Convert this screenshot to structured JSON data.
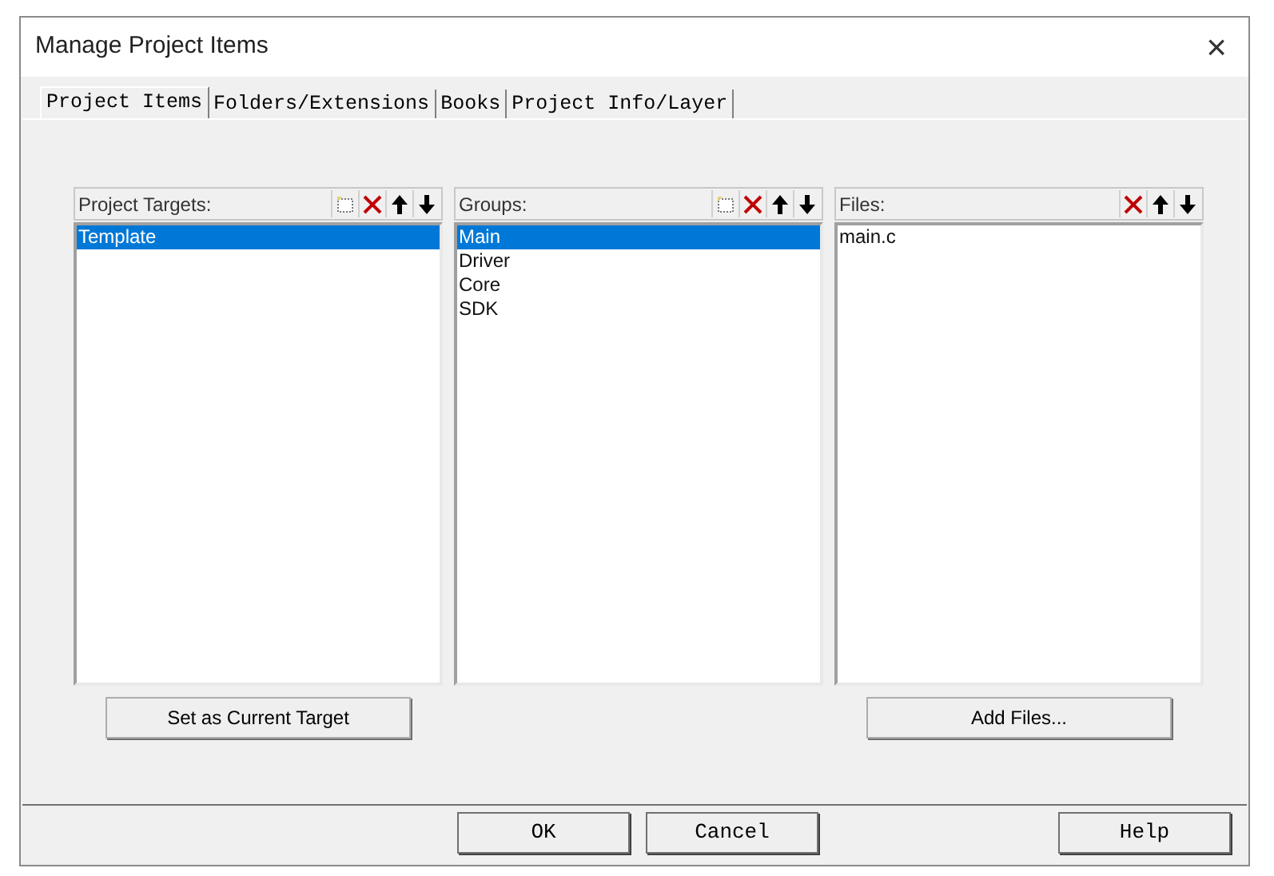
{
  "window": {
    "title": "Manage Project Items",
    "close": "×"
  },
  "tabs": [
    {
      "label": "Project Items",
      "selected": true
    },
    {
      "label": "Folders/Extensions",
      "selected": false
    },
    {
      "label": "Books",
      "selected": false
    },
    {
      "label": "Project Info/Layer",
      "selected": false
    }
  ],
  "panels": [
    {
      "title": "Project Targets:",
      "tools": [
        {
          "kind": "new"
        },
        {
          "kind": "delete"
        },
        {
          "kind": "up"
        },
        {
          "kind": "down"
        }
      ],
      "items": [
        {
          "label": "Template",
          "selected": true
        }
      ],
      "button": "Set as Current Target"
    },
    {
      "title": "Groups:",
      "tools": [
        {
          "kind": "new"
        },
        {
          "kind": "delete"
        },
        {
          "kind": "up"
        },
        {
          "kind": "down"
        }
      ],
      "items": [
        {
          "label": "Main",
          "selected": true
        },
        {
          "label": "Driver",
          "selected": false
        },
        {
          "label": "Core",
          "selected": false
        },
        {
          "label": "SDK",
          "selected": false
        }
      ]
    },
    {
      "title": "Files:",
      "tools": [
        {
          "kind": "delete"
        },
        {
          "kind": "up"
        },
        {
          "kind": "down"
        }
      ],
      "items": [
        {
          "label": "main.c",
          "selected": false
        }
      ],
      "button": "Add Files..."
    }
  ],
  "buttons": [
    {
      "label": "OK"
    },
    {
      "label": "Cancel"
    },
    {
      "label": "Help"
    }
  ]
}
